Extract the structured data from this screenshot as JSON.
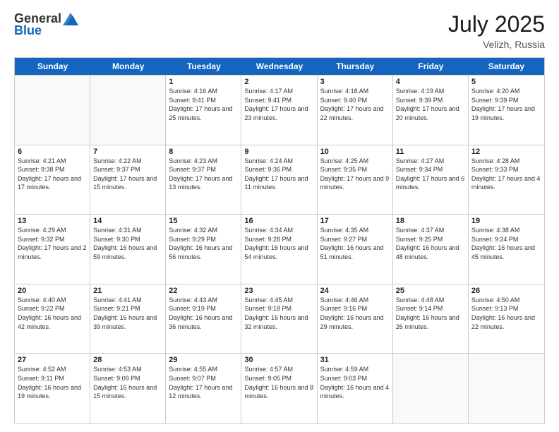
{
  "header": {
    "logo_general": "General",
    "logo_blue": "Blue",
    "month_year": "July 2025",
    "location": "Velizh, Russia"
  },
  "days_of_week": [
    "Sunday",
    "Monday",
    "Tuesday",
    "Wednesday",
    "Thursday",
    "Friday",
    "Saturday"
  ],
  "weeks": [
    [
      {
        "day": "",
        "empty": true
      },
      {
        "day": "",
        "empty": true
      },
      {
        "day": "1",
        "sunrise": "Sunrise: 4:16 AM",
        "sunset": "Sunset: 9:41 PM",
        "daylight": "Daylight: 17 hours and 25 minutes."
      },
      {
        "day": "2",
        "sunrise": "Sunrise: 4:17 AM",
        "sunset": "Sunset: 9:41 PM",
        "daylight": "Daylight: 17 hours and 23 minutes."
      },
      {
        "day": "3",
        "sunrise": "Sunrise: 4:18 AM",
        "sunset": "Sunset: 9:40 PM",
        "daylight": "Daylight: 17 hours and 22 minutes."
      },
      {
        "day": "4",
        "sunrise": "Sunrise: 4:19 AM",
        "sunset": "Sunset: 9:39 PM",
        "daylight": "Daylight: 17 hours and 20 minutes."
      },
      {
        "day": "5",
        "sunrise": "Sunrise: 4:20 AM",
        "sunset": "Sunset: 9:39 PM",
        "daylight": "Daylight: 17 hours and 19 minutes."
      }
    ],
    [
      {
        "day": "6",
        "sunrise": "Sunrise: 4:21 AM",
        "sunset": "Sunset: 9:38 PM",
        "daylight": "Daylight: 17 hours and 17 minutes."
      },
      {
        "day": "7",
        "sunrise": "Sunrise: 4:22 AM",
        "sunset": "Sunset: 9:37 PM",
        "daylight": "Daylight: 17 hours and 15 minutes."
      },
      {
        "day": "8",
        "sunrise": "Sunrise: 4:23 AM",
        "sunset": "Sunset: 9:37 PM",
        "daylight": "Daylight: 17 hours and 13 minutes."
      },
      {
        "day": "9",
        "sunrise": "Sunrise: 4:24 AM",
        "sunset": "Sunset: 9:36 PM",
        "daylight": "Daylight: 17 hours and 11 minutes."
      },
      {
        "day": "10",
        "sunrise": "Sunrise: 4:25 AM",
        "sunset": "Sunset: 9:35 PM",
        "daylight": "Daylight: 17 hours and 9 minutes."
      },
      {
        "day": "11",
        "sunrise": "Sunrise: 4:27 AM",
        "sunset": "Sunset: 9:34 PM",
        "daylight": "Daylight: 17 hours and 6 minutes."
      },
      {
        "day": "12",
        "sunrise": "Sunrise: 4:28 AM",
        "sunset": "Sunset: 9:33 PM",
        "daylight": "Daylight: 17 hours and 4 minutes."
      }
    ],
    [
      {
        "day": "13",
        "sunrise": "Sunrise: 4:29 AM",
        "sunset": "Sunset: 9:32 PM",
        "daylight": "Daylight: 17 hours and 2 minutes."
      },
      {
        "day": "14",
        "sunrise": "Sunrise: 4:31 AM",
        "sunset": "Sunset: 9:30 PM",
        "daylight": "Daylight: 16 hours and 59 minutes."
      },
      {
        "day": "15",
        "sunrise": "Sunrise: 4:32 AM",
        "sunset": "Sunset: 9:29 PM",
        "daylight": "Daylight: 16 hours and 56 minutes."
      },
      {
        "day": "16",
        "sunrise": "Sunrise: 4:34 AM",
        "sunset": "Sunset: 9:28 PM",
        "daylight": "Daylight: 16 hours and 54 minutes."
      },
      {
        "day": "17",
        "sunrise": "Sunrise: 4:35 AM",
        "sunset": "Sunset: 9:27 PM",
        "daylight": "Daylight: 16 hours and 51 minutes."
      },
      {
        "day": "18",
        "sunrise": "Sunrise: 4:37 AM",
        "sunset": "Sunset: 9:25 PM",
        "daylight": "Daylight: 16 hours and 48 minutes."
      },
      {
        "day": "19",
        "sunrise": "Sunrise: 4:38 AM",
        "sunset": "Sunset: 9:24 PM",
        "daylight": "Daylight: 16 hours and 45 minutes."
      }
    ],
    [
      {
        "day": "20",
        "sunrise": "Sunrise: 4:40 AM",
        "sunset": "Sunset: 9:22 PM",
        "daylight": "Daylight: 16 hours and 42 minutes."
      },
      {
        "day": "21",
        "sunrise": "Sunrise: 4:41 AM",
        "sunset": "Sunset: 9:21 PM",
        "daylight": "Daylight: 16 hours and 39 minutes."
      },
      {
        "day": "22",
        "sunrise": "Sunrise: 4:43 AM",
        "sunset": "Sunset: 9:19 PM",
        "daylight": "Daylight: 16 hours and 36 minutes."
      },
      {
        "day": "23",
        "sunrise": "Sunrise: 4:45 AM",
        "sunset": "Sunset: 9:18 PM",
        "daylight": "Daylight: 16 hours and 32 minutes."
      },
      {
        "day": "24",
        "sunrise": "Sunrise: 4:46 AM",
        "sunset": "Sunset: 9:16 PM",
        "daylight": "Daylight: 16 hours and 29 minutes."
      },
      {
        "day": "25",
        "sunrise": "Sunrise: 4:48 AM",
        "sunset": "Sunset: 9:14 PM",
        "daylight": "Daylight: 16 hours and 26 minutes."
      },
      {
        "day": "26",
        "sunrise": "Sunrise: 4:50 AM",
        "sunset": "Sunset: 9:13 PM",
        "daylight": "Daylight: 16 hours and 22 minutes."
      }
    ],
    [
      {
        "day": "27",
        "sunrise": "Sunrise: 4:52 AM",
        "sunset": "Sunset: 9:11 PM",
        "daylight": "Daylight: 16 hours and 19 minutes."
      },
      {
        "day": "28",
        "sunrise": "Sunrise: 4:53 AM",
        "sunset": "Sunset: 9:09 PM",
        "daylight": "Daylight: 16 hours and 15 minutes."
      },
      {
        "day": "29",
        "sunrise": "Sunrise: 4:55 AM",
        "sunset": "Sunset: 9:07 PM",
        "daylight": "Daylight: 17 hours and 12 minutes."
      },
      {
        "day": "30",
        "sunrise": "Sunrise: 4:57 AM",
        "sunset": "Sunset: 9:05 PM",
        "daylight": "Daylight: 16 hours and 8 minutes."
      },
      {
        "day": "31",
        "sunrise": "Sunrise: 4:59 AM",
        "sunset": "Sunset: 9:03 PM",
        "daylight": "Daylight: 16 hours and 4 minutes."
      },
      {
        "day": "",
        "empty": true
      },
      {
        "day": "",
        "empty": true
      }
    ]
  ]
}
